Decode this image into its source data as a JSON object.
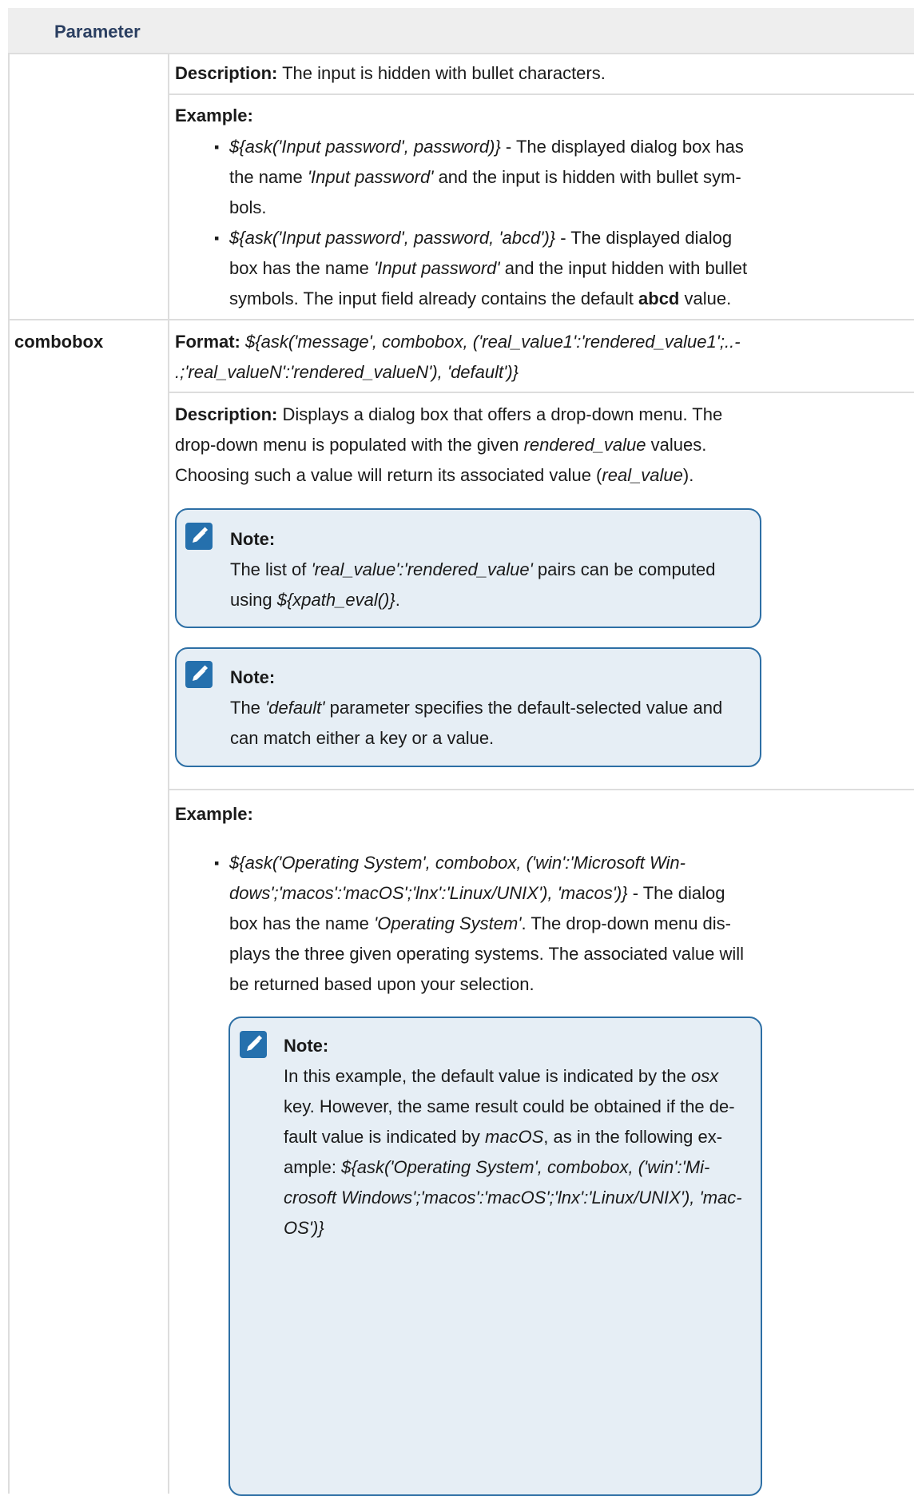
{
  "header": {
    "column_label": "Parameter"
  },
  "password_row": {
    "description_label": "Description:",
    "description_text": " The input is hidden with bullet characters.",
    "example_label": "Example:",
    "ex1": {
      "code": "${ask('Input password', password)}",
      "l1_rest": " - The displayed dialog box has",
      "l2_pre": "the name ",
      "l2_name": "'Input password'",
      "l2_post": " and the input is hidden with bullet sym-",
      "l3": "bols."
    },
    "ex2": {
      "code": "${ask('Input password', password, 'abcd')}",
      "l1_rest": " - The displayed dialog",
      "l2_pre": "box has the name ",
      "l2_name": "'Input password'",
      "l2_post": " and the input hidden with bullet",
      "l3_pre": "symbols. The input field already contains the default ",
      "l3_bold": "abcd",
      "l3_post": " value."
    }
  },
  "combobox_row": {
    "name": "combobox",
    "format_label": "Format:",
    "format_l1": " ${ask('message', combobox, ('real_value1':'rendered_value1';..-",
    "format_l2": ".;'real_valueN':'rendered_valueN'), 'default')}",
    "description_label": "Description:",
    "description_l1": " Displays a dialog box that offers a drop-down menu. The",
    "description_l2_pre": "drop-down menu is populated with the given ",
    "description_l2_em": "rendered_value",
    "description_l2_post": " values.",
    "description_l3_pre": "Choosing such a value will return its associated value (",
    "description_l3_em": "real_value",
    "description_l3_post": ").",
    "note1": {
      "title": "Note:",
      "l1_pre": "The list of ",
      "l1_em": "'real_value':'rendered_value'",
      "l1_post": " pairs can be computed",
      "l2_pre": "using ",
      "l2_em": "${xpath_eval()}",
      "l2_post": "."
    },
    "note2": {
      "title": "Note:",
      "l1_pre": "The ",
      "l1_em": "'default'",
      "l1_post": " parameter specifies the default-selected value and",
      "l2": "can match either a key or a value."
    },
    "example_label": "Example:",
    "example": {
      "l1": "${ask('Operating System', combobox, ('win':'Microsoft Win-",
      "l2_em": "dows';'macos':'macOS';'lnx':'Linux/UNIX'), 'macos')}",
      "l2_post": " - The dialog",
      "l3_pre": "box has the name ",
      "l3_em": "'Operating System'",
      "l3_post": ". The drop-down menu dis-",
      "l4": "plays the three given operating systems. The associated value will",
      "l5": "be returned based upon your selection."
    },
    "note3": {
      "title": "Note:",
      "l1_pre": "In this example, the default value is indicated by the ",
      "l1_em": "osx",
      "l2": "key. However, the same result could be obtained if the de-",
      "l3_pre": "fault value is indicated by ",
      "l3_em": "macOS",
      "l3_post": ", as in the following ex-",
      "l4_pre": "ample: ",
      "l4_em": "${ask('Operating System', combobox, ('win':'Mi-",
      "l5_em": "crosoft Windows';'macos':'macOS';'lnx':'Linux/UNIX'), 'mac-",
      "l6_em": "OS')}"
    }
  },
  "colors": {
    "header_bg": "#eeeeee",
    "header_text": "#2b3f61",
    "note_bg": "#e6eef5",
    "note_border": "#2d6fa5",
    "note_icon": "#2570ad"
  },
  "icons": [
    "pencil-note-icon"
  ]
}
